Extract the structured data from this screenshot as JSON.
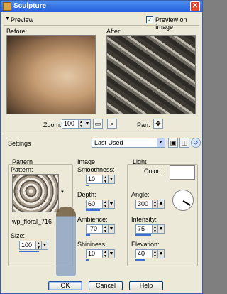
{
  "window": {
    "title": "Sculpture"
  },
  "preview": {
    "toggle_label": "Preview",
    "preview_on_image_label": "Preview on Image",
    "preview_on_image_checked": "✓",
    "before_label": "Before:",
    "after_label": "After:",
    "zoom_label": "Zoom:",
    "zoom_value": "100",
    "pan_label": "Pan:"
  },
  "settings": {
    "label": "Settings",
    "preset_value": "Last Used"
  },
  "pattern": {
    "group_label": "Pattern",
    "pattern_label": "Pattern:",
    "pattern_name": "wp_floral_716",
    "size_label": "Size:",
    "size_value": "100"
  },
  "image": {
    "group_label": "Image",
    "smoothness_label": "Smoothness:",
    "smoothness_value": "10",
    "depth_label": "Depth:",
    "depth_value": "60",
    "ambience_label": "Ambience:",
    "ambience_value": "-70",
    "shininess_label": "Shininess:",
    "shininess_value": "10"
  },
  "light": {
    "group_label": "Light",
    "color_label": "Color:",
    "angle_label": "Angle:",
    "angle_value": "300",
    "intensity_label": "Intensity:",
    "intensity_value": "75",
    "elevation_label": "Elevation:",
    "elevation_value": "40"
  },
  "buttons": {
    "ok": "OK",
    "cancel": "Cancel",
    "help": "Help"
  },
  "colors": {
    "titlebar": "#245edb",
    "slider_fill": "#3d6fd7",
    "dialog_bg": "#ece9d8"
  }
}
